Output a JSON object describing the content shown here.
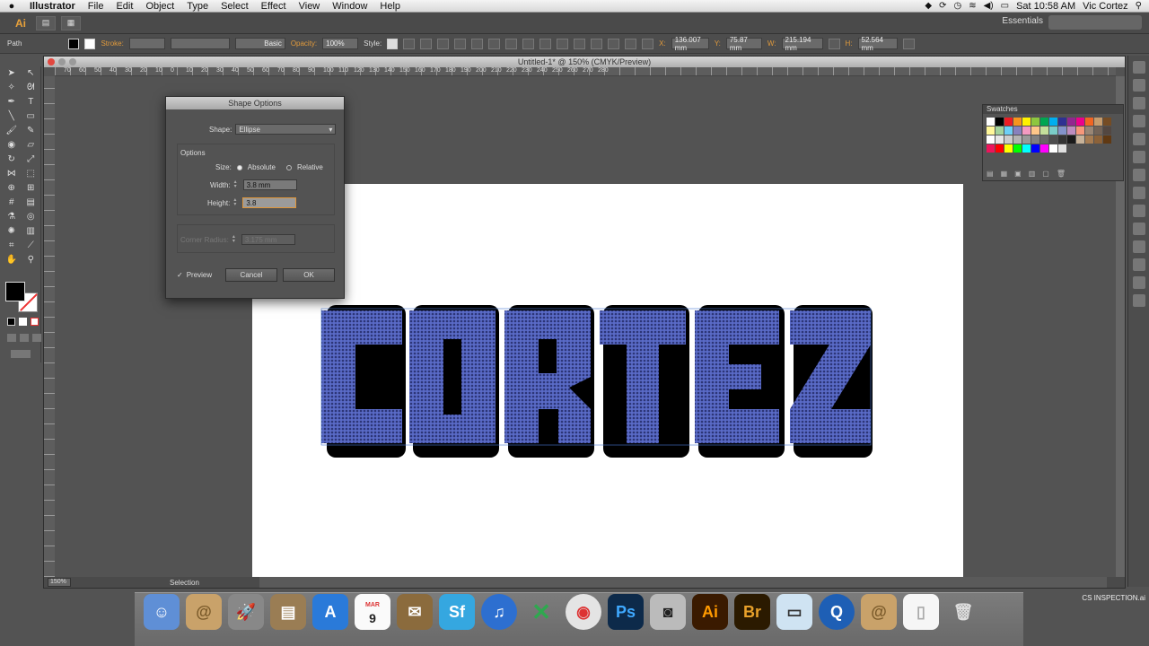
{
  "menubar": {
    "app_name": "Illustrator",
    "items": [
      "File",
      "Edit",
      "Object",
      "Type",
      "Select",
      "Effect",
      "View",
      "Window",
      "Help"
    ],
    "clock": "Sat 10:58 AM",
    "user": "Vic Cortez"
  },
  "appbar": {
    "logo": "Ai",
    "workspace": "Essentials"
  },
  "controlbar": {
    "selection_type": "Path",
    "stroke_label": "Stroke:",
    "brush": "Basic",
    "opacity_label": "Opacity:",
    "opacity_value": "100%",
    "style_label": "Style:",
    "x_label": "X:",
    "x_value": "136.007 mm",
    "y_label": "Y:",
    "y_value": "75.87 mm",
    "w_label": "W:",
    "w_value": "215.194 mm",
    "h_label": "H:",
    "h_value": "52.564 mm"
  },
  "document": {
    "title": "Untitled-1* @ 150% (CMYK/Preview)",
    "zoom": "150%",
    "status": "Selection",
    "ruler_numbers": [
      "70",
      "60",
      "50",
      "40",
      "30",
      "20",
      "10",
      "0",
      "10",
      "20",
      "30",
      "40",
      "50",
      "60",
      "70",
      "80",
      "90",
      "100",
      "110",
      "120",
      "130",
      "140",
      "150",
      "160",
      "170",
      "180",
      "190",
      "200",
      "210",
      "220",
      "230",
      "240",
      "250",
      "260",
      "270",
      "280"
    ],
    "artwork_text": "CORTEZ"
  },
  "dialog": {
    "title": "Shape Options",
    "shape_label": "Shape:",
    "shape_value": "Ellipse",
    "options_label": "Options",
    "size_label": "Size:",
    "size_absolute": "Absolute",
    "size_relative": "Relative",
    "width_label": "Width:",
    "width_value": "3.8 mm",
    "height_label": "Height:",
    "height_value": "3.8",
    "corner_label": "Corner Radius:",
    "corner_value": "3.175 mm",
    "preview_label": "Preview",
    "cancel": "Cancel",
    "ok": "OK"
  },
  "swatches": {
    "title": "Swatches"
  },
  "dock": {
    "calendar_month": "MAR",
    "calendar_day": "9",
    "apps": [
      "Finder",
      "Mail",
      "Launchpad",
      "Preview",
      "App Store",
      "Calendar",
      "Mail Stamp",
      "Sf",
      "iTunes",
      "Excel",
      "Chrome",
      "Ps",
      "Camera",
      "Ai",
      "Br",
      "Monitor",
      "QuickTime",
      "Mail Doc",
      "Doc",
      "Trash"
    ],
    "label": "CS INSPECTION.ai"
  },
  "colors": {
    "artwork_fill": "#5a6bc7",
    "accent": "#e0963a"
  }
}
